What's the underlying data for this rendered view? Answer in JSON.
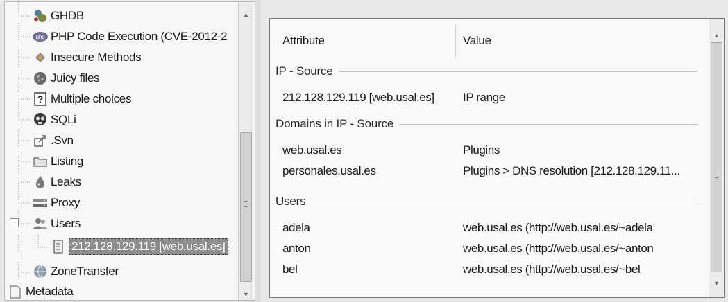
{
  "tree": {
    "items": [
      {
        "label": "GHDB",
        "icon": "ghdb-icon"
      },
      {
        "label": "PHP Code Execution (CVE-2012-2",
        "icon": "php-icon"
      },
      {
        "label": "Insecure Methods",
        "icon": "insecure-methods-icon"
      },
      {
        "label": "Juicy files",
        "icon": "juicy-files-icon"
      },
      {
        "label": "Multiple choices",
        "icon": "question-icon"
      },
      {
        "label": "SQLi",
        "icon": "skull-icon"
      },
      {
        "label": ".Svn",
        "icon": "svn-icon"
      },
      {
        "label": "Listing",
        "icon": "folder-icon"
      },
      {
        "label": "Leaks",
        "icon": "leaks-icon"
      },
      {
        "label": "Proxy",
        "icon": "proxy-icon"
      },
      {
        "label": "Users",
        "icon": "users-icon",
        "expander": "⊟"
      },
      {
        "label": "212.128.129.119 [web.usal.es]",
        "icon": "document-icon",
        "selected": true
      },
      {
        "label": "ZoneTransfer",
        "icon": "zonetransfer-icon"
      },
      {
        "label": "Metadata",
        "icon": "metadata-icon"
      }
    ]
  },
  "list": {
    "columns": {
      "attribute": "Attribute",
      "value": "Value"
    },
    "groups": [
      {
        "title": "IP - Source",
        "rows": [
          {
            "attribute": "212.128.129.119 [web.usal.es]",
            "value": "IP range"
          }
        ]
      },
      {
        "title": "Domains in IP - Source",
        "rows": [
          {
            "attribute": "web.usal.es",
            "value": "Plugins"
          },
          {
            "attribute": "personales.usal.es",
            "value": "Plugins > DNS resolution [212.128.129.11..."
          }
        ]
      },
      {
        "title": "Users",
        "rows": [
          {
            "attribute": "adela",
            "value": "web.usal.es (http://web.usal.es/~adela"
          },
          {
            "attribute": "anton",
            "value": "web.usal.es (http://web.usal.es/~anton"
          },
          {
            "attribute": "bel",
            "value": "web.usal.es (http://web.usal.es/~bel"
          }
        ]
      }
    ]
  },
  "colors": {
    "selection": "#8d8d8d",
    "background": "#f9f9f9",
    "border": "#7a7a7a"
  }
}
